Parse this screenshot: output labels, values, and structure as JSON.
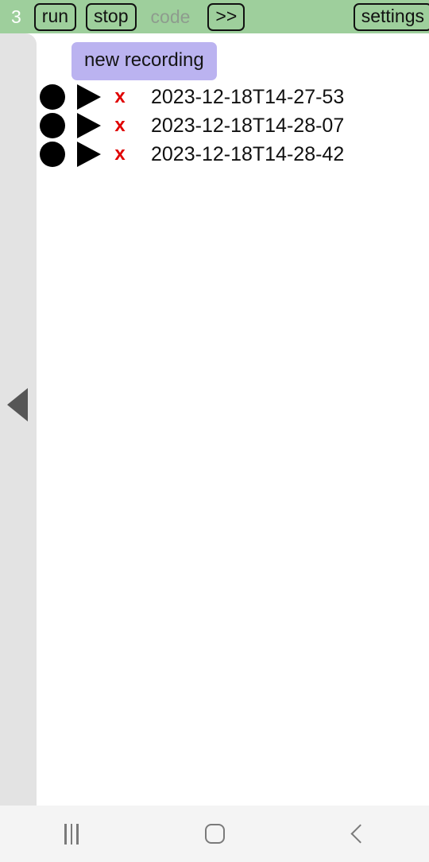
{
  "toolbar": {
    "run_count": "3",
    "run_label": "run",
    "stop_label": "stop",
    "code_label": "code",
    "next_label": ">>",
    "settings_label": "settings",
    "background_color": "#9ecf9c",
    "count_color": "#ffffff",
    "disabled_label_color": "#8e9c8e"
  },
  "sidebar": {
    "collapse_handle_icon": "triangle-left-icon",
    "background_color": "#e3e3e3",
    "handle_color": "#565656"
  },
  "main": {
    "new_recording_label": "new recording",
    "new_recording_color": "#bbb3f0",
    "delete_color": "#e00000",
    "recordings": [
      {
        "record_icon": "record-circle-icon",
        "play_icon": "play-triangle-icon",
        "delete_icon": "x",
        "name": "2023-12-18T14-27-53"
      },
      {
        "record_icon": "record-circle-icon",
        "play_icon": "play-triangle-icon",
        "delete_icon": "x",
        "name": "2023-12-18T14-28-07"
      },
      {
        "record_icon": "record-circle-icon",
        "play_icon": "play-triangle-icon",
        "delete_icon": "x",
        "name": "2023-12-18T14-28-42"
      }
    ]
  },
  "navbar": {
    "recents_icon": "recents-icon",
    "home_icon": "home-icon",
    "back_icon": "back-chevron-icon",
    "background_color": "#f4f4f4",
    "icon_color": "#7a7a7a"
  }
}
